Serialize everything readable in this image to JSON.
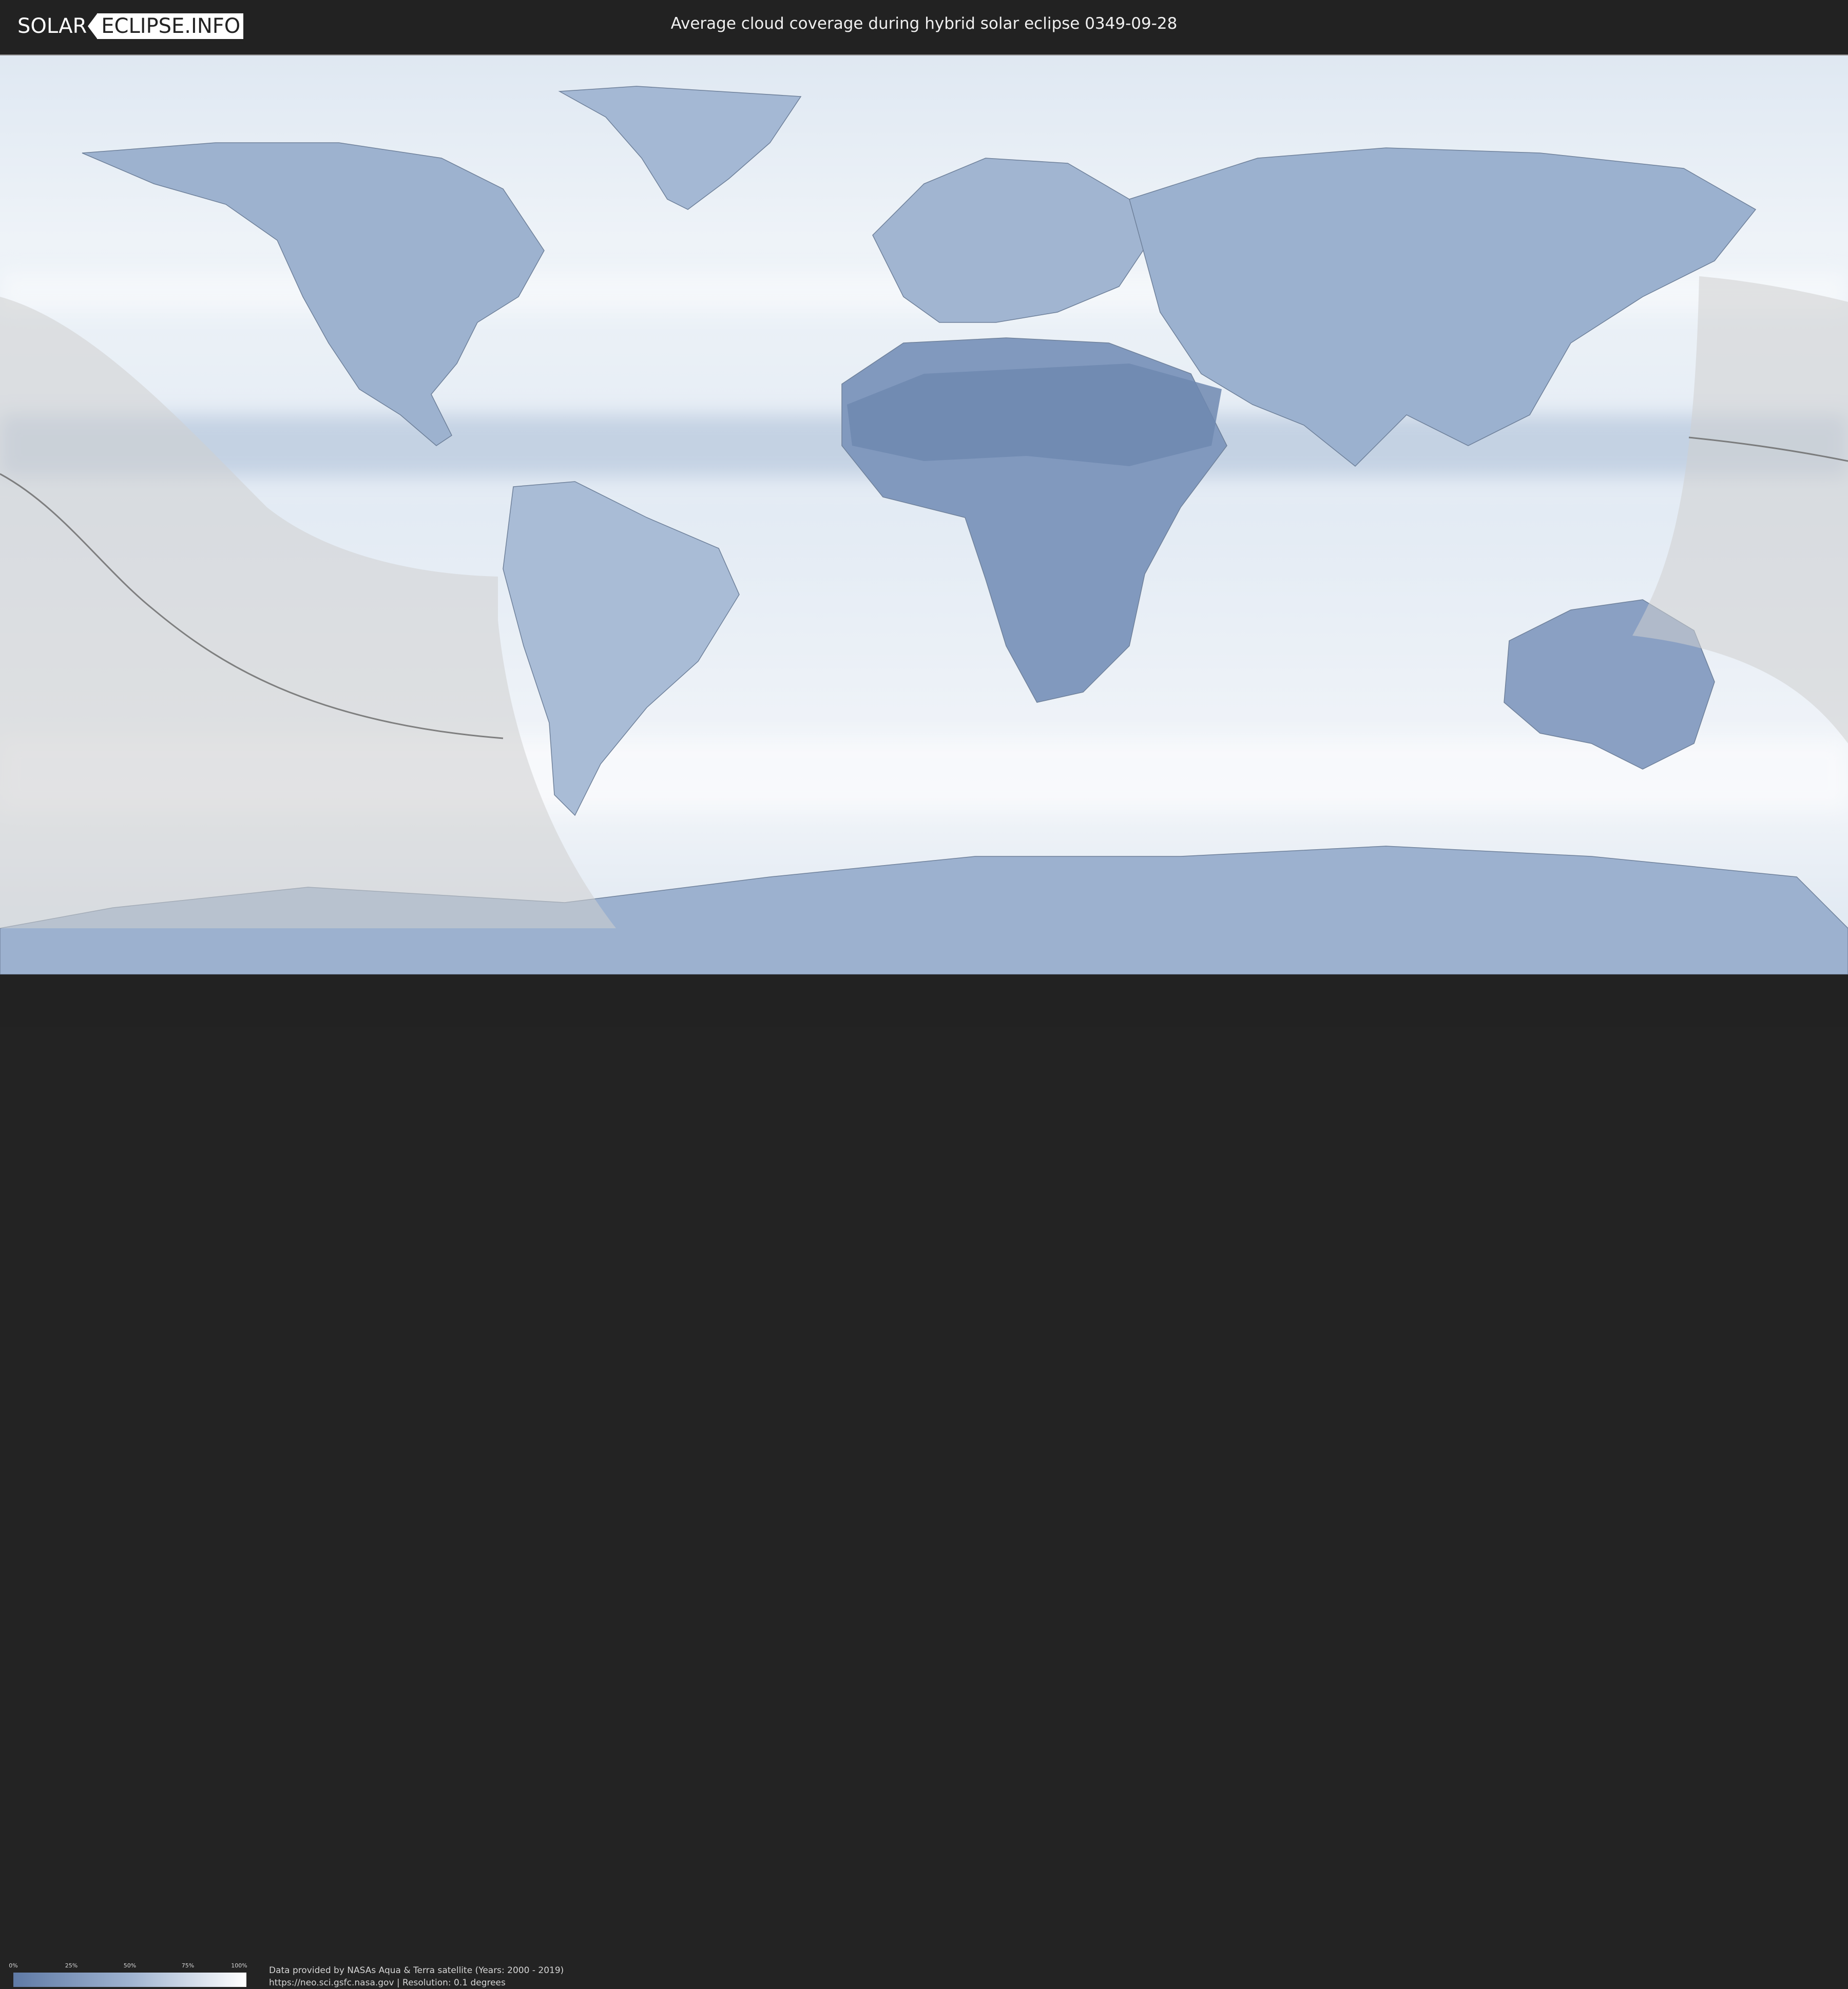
{
  "header": {
    "logo_left": "SOLAR",
    "logo_right": "ECLIPSE.INFO",
    "title": "Average cloud coverage during hybrid solar eclipse 0349-09-28"
  },
  "map": {
    "base_colors": {
      "clear_sky": "#5f7aa6",
      "cloud": "#ffffff",
      "eclipse_overlay": "#c8c8c8",
      "central_line": "#555555"
    }
  },
  "legend": {
    "ticks": [
      "0%",
      "25%",
      "50%",
      "75%",
      "100%"
    ],
    "gradient_start": "#5f7aa6",
    "gradient_end": "#ffffff"
  },
  "credits": {
    "line1": "Data provided by NASAs Aqua & Terra satellite (Years: 2000 - 2019)",
    "line2": "https://neo.sci.gsfc.nasa.gov | Resolution: 0.1 degrees"
  }
}
